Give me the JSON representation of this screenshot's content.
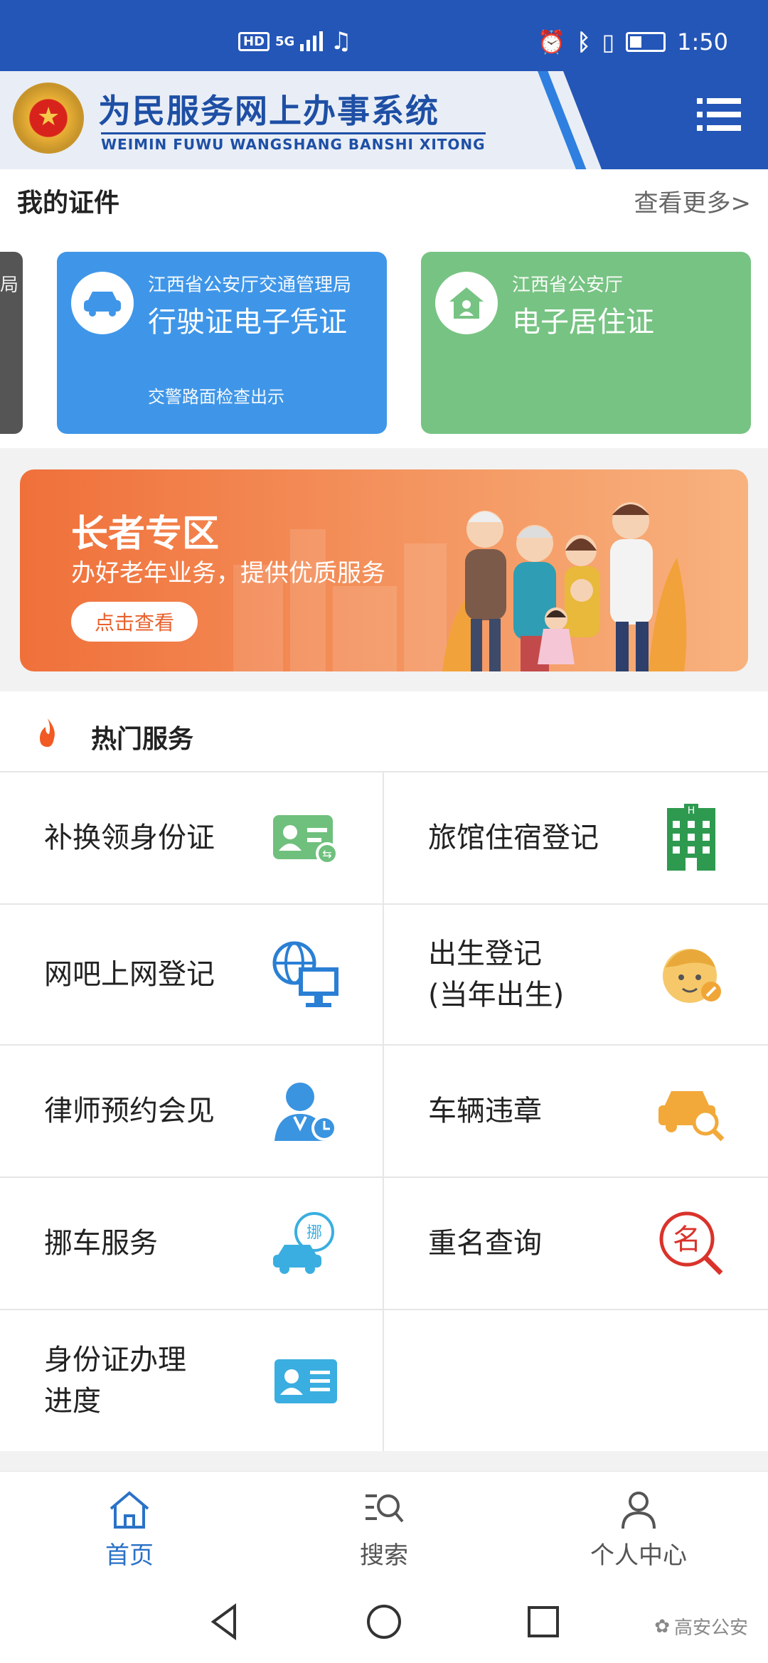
{
  "status_bar": {
    "network": "5G",
    "hd": "HD",
    "time": "1:50"
  },
  "header": {
    "title": "为民服务网上办事系统",
    "subtitle": "WEIMIN FUWU WANGSHANG BANSHI XITONG"
  },
  "certificates": {
    "title": "我的证件",
    "more": "查看更多>",
    "peek_text": "局",
    "cards": [
      {
        "org": "江西省公安厅交通管理局",
        "name": "行驶证电子凭证",
        "note": "交警路面检查出示",
        "icon": "car-icon",
        "color": "#3f96e8"
      },
      {
        "org": "江西省公安厅",
        "name": "电子居住证",
        "note": "",
        "icon": "house-icon",
        "color": "#77c383"
      }
    ]
  },
  "banner": {
    "title": "长者专区",
    "subtitle": "办好老年业务，提供优质服务",
    "button": "点击查看"
  },
  "hot_services": {
    "title": "热门服务",
    "items": [
      {
        "label": "补换领身份证",
        "icon": "id-card-replace-icon"
      },
      {
        "label": "旅馆住宿登记",
        "icon": "hotel-icon"
      },
      {
        "label": "网吧上网登记",
        "icon": "internet-cafe-icon"
      },
      {
        "label": "出生登记",
        "label2": "(当年出生)",
        "icon": "baby-icon"
      },
      {
        "label": "律师预约会见",
        "icon": "lawyer-appointment-icon"
      },
      {
        "label": "车辆违章",
        "icon": "car-search-icon"
      },
      {
        "label": "挪车服务",
        "icon": "move-car-icon"
      },
      {
        "label": "重名查询",
        "icon": "name-search-icon"
      },
      {
        "label": "身份证办理",
        "label2": "进度",
        "icon": "id-card-icon"
      }
    ]
  },
  "tabs": [
    {
      "label": "首页",
      "icon": "home-icon",
      "active": true
    },
    {
      "label": "搜索",
      "icon": "search-icon",
      "active": false
    },
    {
      "label": "个人中心",
      "icon": "user-icon",
      "active": false
    }
  ],
  "watermark": "高安公安"
}
